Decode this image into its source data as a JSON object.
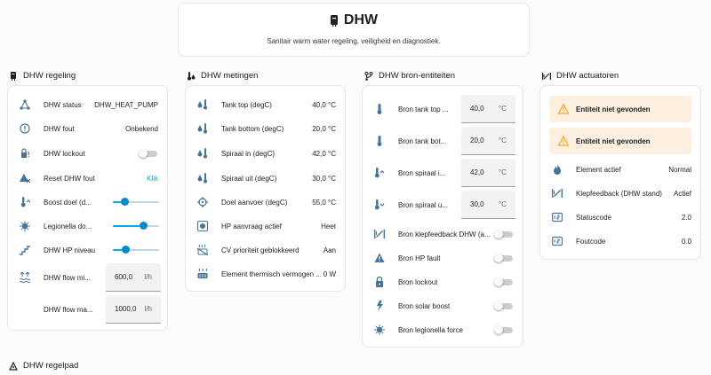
{
  "header": {
    "title": "DHW",
    "subtitle": "Sanitair warm water regeling, veiligheid en diagnostiek."
  },
  "regeling": {
    "title": "DHW regeling",
    "status_label": "DHW status",
    "status_value": "DHW_HEAT_PUMP",
    "fout_label": "DHW fout",
    "fout_value": "Onbekend",
    "lockout_label": "DHW lockout",
    "reset_label": "Reset DHW fout",
    "reset_action": "Klik",
    "boost_label": "Boost doel (d...",
    "boost_level": 0.25,
    "legionella_label": "Legionella do...",
    "legionella_level": 0.65,
    "hp_niveau_label": "DHW HP niveau",
    "hp_niveau_level": 0.27,
    "flow_min_label": "DHW flow mi...",
    "flow_min_value": "600,0",
    "flow_min_unit": "l/h",
    "flow_max_label": "DHW flow ma...",
    "flow_max_value": "1000,0",
    "flow_max_unit": "l/h"
  },
  "metingen": {
    "title": "DHW metingen",
    "rows": [
      {
        "label": "Tank top (degC)",
        "value": "40,0 °C"
      },
      {
        "label": "Tank bottom (degC)",
        "value": "20,0 °C"
      },
      {
        "label": "Spiraal in (degC)",
        "value": "42,0 °C"
      },
      {
        "label": "Spiraal uit (degC)",
        "value": "30,0 °C"
      },
      {
        "label": "Doel aanvoer (degC)",
        "value": "55,0 °C"
      },
      {
        "label": "HP aanvraag actief",
        "value": "Heet"
      },
      {
        "label": "CV prioriteit geblokkeerd",
        "value": "Aan"
      },
      {
        "label": "Element thermisch vermogen ...",
        "value": "0 W"
      }
    ]
  },
  "bron": {
    "title": "DHW bron-entiteiten",
    "numbers": [
      {
        "label": "Bron tank top ...",
        "value": "40,0",
        "unit": "°C"
      },
      {
        "label": "Bron tank bot...",
        "value": "20,0",
        "unit": "°C"
      },
      {
        "label": "Bron spiraal i...",
        "value": "42,0",
        "unit": "°C"
      },
      {
        "label": "Bron spiraal u...",
        "value": "30,0",
        "unit": "°C"
      }
    ],
    "toggles": [
      {
        "label": "Bron klepfeedback DHW (a..."
      },
      {
        "label": "Bron HP fault"
      },
      {
        "label": "Bron lockout"
      },
      {
        "label": "Bron solar boost"
      },
      {
        "label": "Bron legionella force"
      }
    ]
  },
  "actuatoren": {
    "title": "DHW actuatoren",
    "warn1": "Entiteit niet gevonden",
    "warn2": "Entiteit niet gevonden",
    "rows": [
      {
        "label": "Element actief",
        "value": "Normal"
      },
      {
        "label": "Klepfeedback (DHW stand)",
        "value": "Actief"
      },
      {
        "label": "Statuscode",
        "value": "2.0"
      },
      {
        "label": "Foutcode",
        "value": "0.0"
      }
    ]
  },
  "regelpad": {
    "title": "DHW regelpad"
  },
  "colors": {
    "accent": "#03a9f4",
    "icon": "#44739e",
    "warning": "#f9a825"
  }
}
